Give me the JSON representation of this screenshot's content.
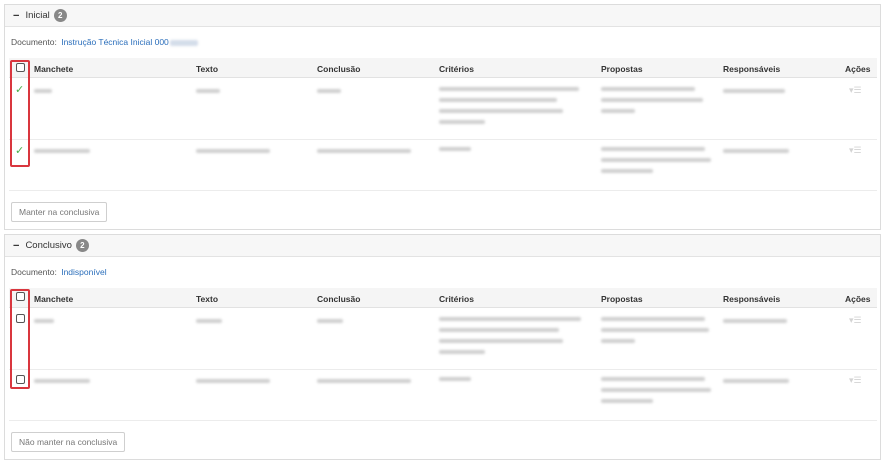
{
  "columns": {
    "manchete": "Manchete",
    "texto": "Texto",
    "conclusao": "Conclusão",
    "criterios": "Critérios",
    "propostas": "Propostas",
    "responsaveis": "Responsáveis",
    "acoes": "Ações"
  },
  "sections": [
    {
      "title": "Inicial",
      "count": "2",
      "document_label": "Documento:",
      "document_value": "Instrução Técnica Inicial 000",
      "button_label": "Manter na conclusiva",
      "rows_state": "checked"
    },
    {
      "title": "Conclusivo",
      "count": "2",
      "document_label": "Documento:",
      "document_value": "Indisponível",
      "button_label": "Não manter na conclusiva",
      "rows_state": "unchecked"
    }
  ],
  "icons": {
    "collapse": "minus-icon",
    "check": "checkmark-icon",
    "actions": "caret-menu-icon"
  },
  "colors": {
    "highlight": "#d9363e",
    "link": "#2a6ebb",
    "check": "#49b04a"
  }
}
